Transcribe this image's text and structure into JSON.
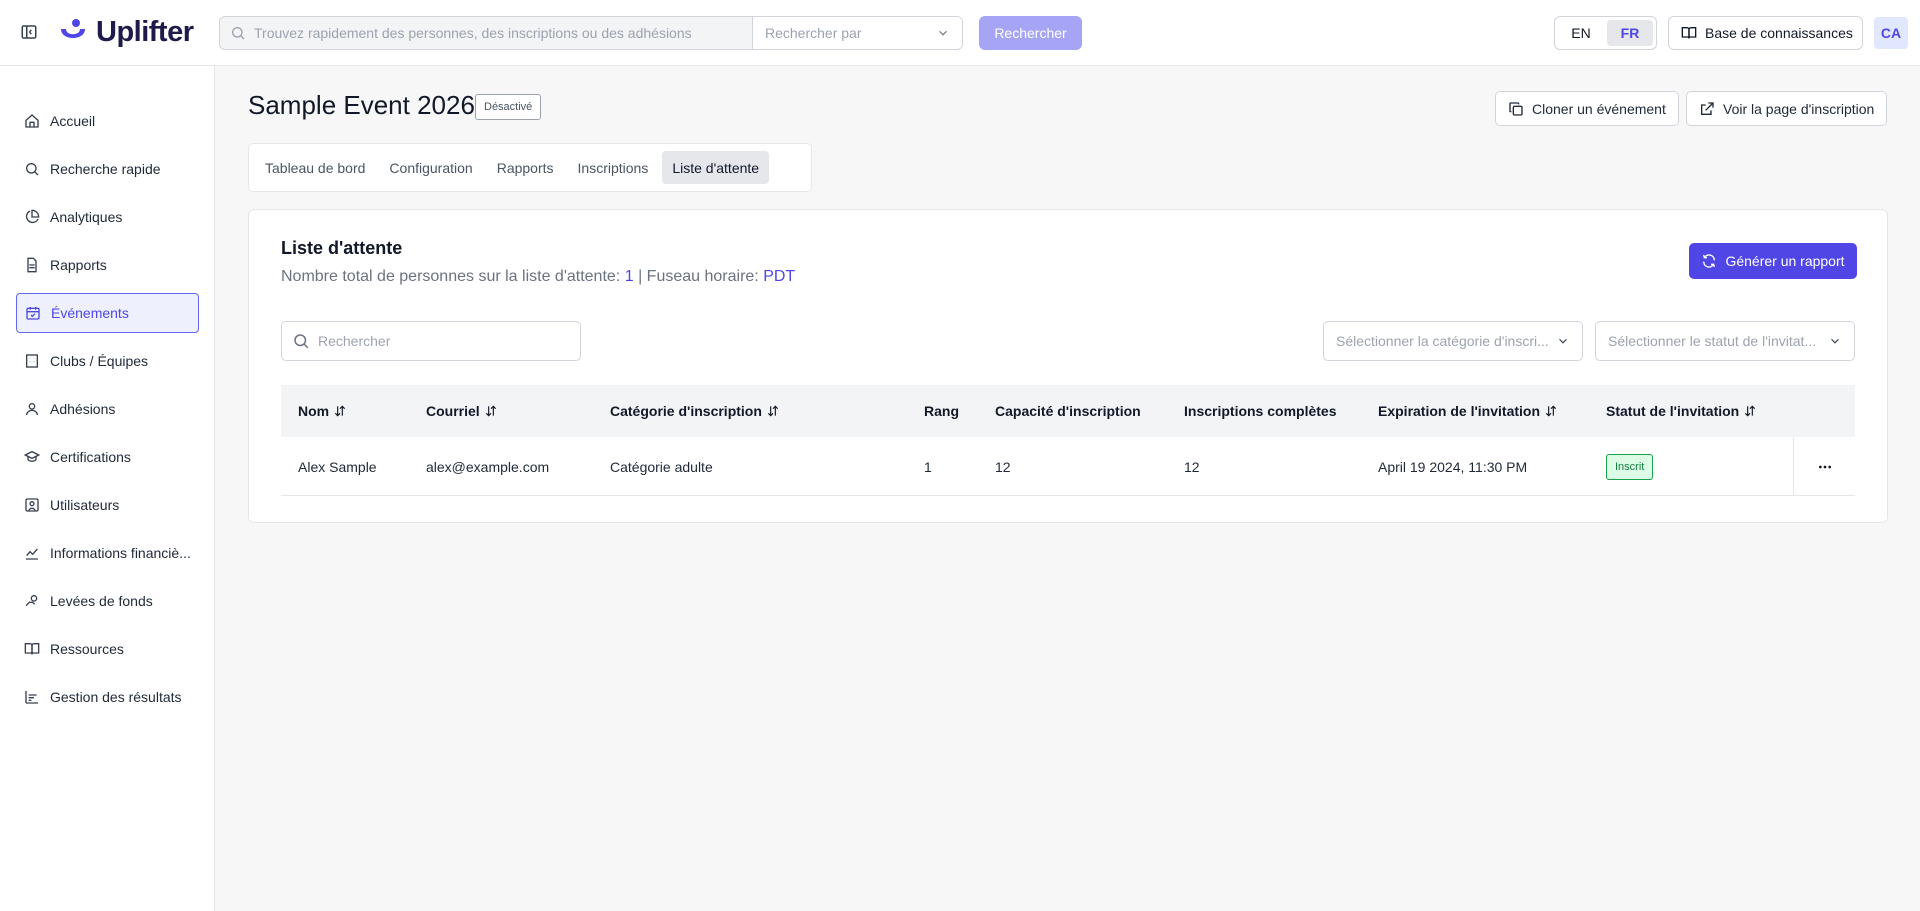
{
  "header": {
    "app_name": "Uplifter",
    "search_placeholder": "Trouvez rapidement des personnes, des inscriptions ou des adhésions",
    "search_by_placeholder": "Rechercher par",
    "search_button": "Rechercher",
    "languages": [
      "EN",
      "FR"
    ],
    "active_language": "FR",
    "knowledge_base": "Base de connaissances",
    "avatar_initials": "CA"
  },
  "sidebar": {
    "items": [
      {
        "label": "Accueil",
        "icon": "home-icon"
      },
      {
        "label": "Recherche rapide",
        "icon": "search-icon"
      },
      {
        "label": "Analytiques",
        "icon": "pie-chart-icon"
      },
      {
        "label": "Rapports",
        "icon": "file-text-icon"
      },
      {
        "label": "Événements",
        "icon": "calendar-icon",
        "active": true
      },
      {
        "label": "Clubs / Équipes",
        "icon": "building-icon"
      },
      {
        "label": "Adhésions",
        "icon": "user-icon"
      },
      {
        "label": "Certifications",
        "icon": "graduation-cap-icon"
      },
      {
        "label": "Utilisateurs",
        "icon": "user-square-icon"
      },
      {
        "label": "Informations financiè...",
        "icon": "bar-chart-icon"
      },
      {
        "label": "Levées de fonds",
        "icon": "hand-coins-icon"
      },
      {
        "label": "Ressources",
        "icon": "book-icon"
      },
      {
        "label": "Gestion des résultats",
        "icon": "chart-icon"
      }
    ]
  },
  "event": {
    "title": "Sample Event 2026",
    "status": "Désactivé",
    "clone_button": "Cloner un événement",
    "view_page_button": "Voir la page d'inscription"
  },
  "tabs": [
    "Tableau de bord",
    "Configuration",
    "Rapports",
    "Inscriptions",
    "Liste d'attente"
  ],
  "active_tab": "Liste d'attente",
  "waitlist": {
    "title": "Liste d'attente",
    "total_label": "Nombre total de personnes sur la liste d'attente:",
    "total_value": "1",
    "separator": "|",
    "timezone_label": "Fuseau horaire:",
    "timezone_value": "PDT",
    "generate_button": "Générer un rapport",
    "search_placeholder": "Rechercher",
    "category_select_placeholder": "Sélectionner la catégorie d'inscri...",
    "status_select_placeholder": "Sélectionner le statut de l'invitat..."
  },
  "table": {
    "columns": [
      "Nom",
      "Courriel",
      "Catégorie d'inscription",
      "Rang",
      "Capacité d'inscription",
      "Inscriptions complètes",
      "Expiration de l'invitation",
      "Statut de l'invitation"
    ],
    "rows": [
      {
        "name": "Alex Sample",
        "email": "alex@example.com",
        "category": "Catégorie adulte",
        "rank": "1",
        "capacity": "12",
        "completed": "12",
        "expiration": "April 19 2024, 11:30 PM",
        "status": "Inscrit"
      }
    ]
  },
  "colors": {
    "brand": "#4f46e5",
    "status_registered": "#15803d"
  }
}
